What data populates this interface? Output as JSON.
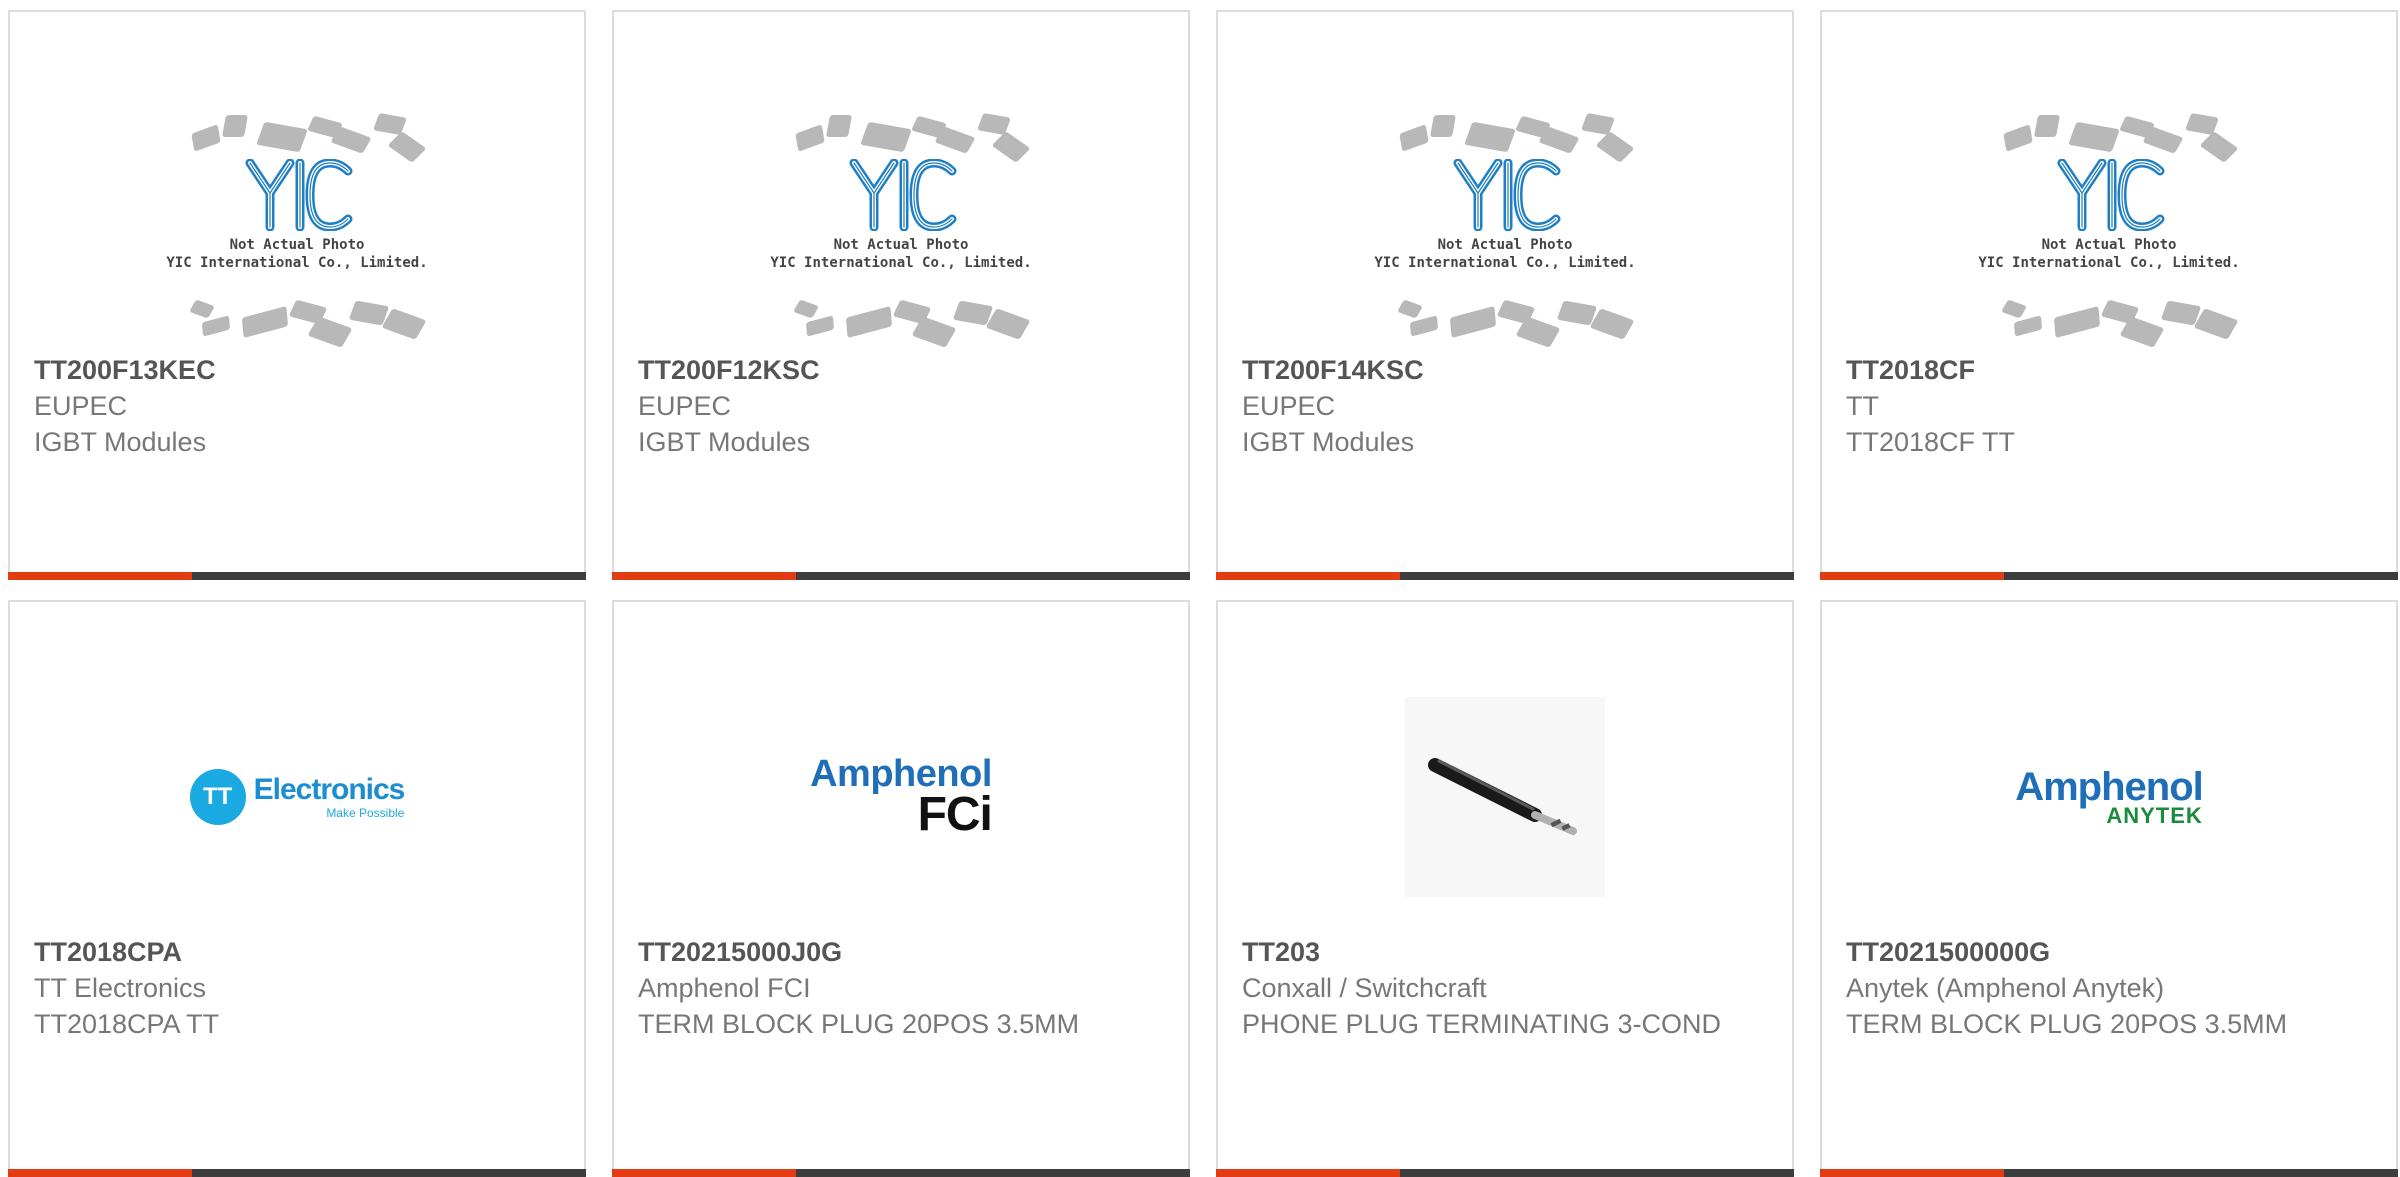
{
  "placeholder": {
    "line1": "Not Actual Photo",
    "line2": "YIC International Co., Limited."
  },
  "brand_logos": {
    "tt": {
      "circle": "TT",
      "word": "Electronics",
      "tagline": "Make Possible",
      "color": "#1aa9e0"
    },
    "amphenol_fci": {
      "top": "Amphenol",
      "bottom": "FCi",
      "color": "#1f6fb8"
    },
    "amphenol_anytek": {
      "top": "Amphenol",
      "bottom": "ANYTEK",
      "color": "#1f6fb8",
      "accent": "#1c8a3c"
    }
  },
  "colors": {
    "accent": "#e33b12",
    "bar": "#3d3d3d",
    "border": "#dcdcdc"
  },
  "products": [
    {
      "part_number": "TT200F13KEC",
      "manufacturer": "EUPEC",
      "description": "IGBT Modules",
      "image": "not-actual-photo"
    },
    {
      "part_number": "TT200F12KSC",
      "manufacturer": "EUPEC",
      "description": "IGBT Modules",
      "image": "not-actual-photo"
    },
    {
      "part_number": "TT200F14KSC",
      "manufacturer": "EUPEC",
      "description": "IGBT Modules",
      "image": "not-actual-photo"
    },
    {
      "part_number": "TT2018CF",
      "manufacturer": "TT",
      "description": "TT2018CF TT",
      "image": "not-actual-photo"
    },
    {
      "part_number": "TT2018CPA",
      "manufacturer": "TT Electronics",
      "description": "TT2018CPA TT",
      "image": "tt-electronics-logo"
    },
    {
      "part_number": "TT20215000J0G",
      "manufacturer": "Amphenol FCI",
      "description": "TERM BLOCK PLUG 20POS 3.5MM",
      "image": "amphenol-fci-logo"
    },
    {
      "part_number": "TT203",
      "manufacturer": "Conxall / Switchcraft",
      "description": "PHONE PLUG TERMINATING 3-COND",
      "image": "phone-plug-photo"
    },
    {
      "part_number": "TT2021500000G",
      "manufacturer": "Anytek (Amphenol Anytek)",
      "description": "TERM BLOCK PLUG 20POS 3.5MM",
      "image": "amphenol-anytek-logo"
    }
  ]
}
